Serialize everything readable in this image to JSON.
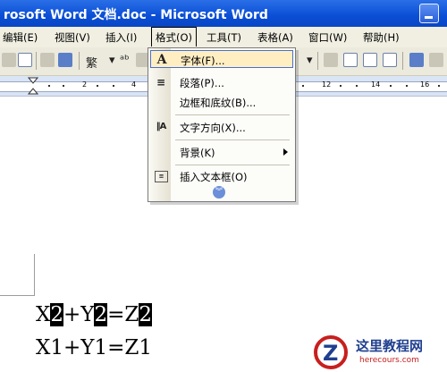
{
  "window": {
    "title": "rosoft Word 文档.doc - Microsoft Word"
  },
  "menubar": {
    "items": [
      {
        "label": "编辑(E)"
      },
      {
        "label": "视图(V)"
      },
      {
        "label": "插入(I)"
      },
      {
        "label": "格式(O)"
      },
      {
        "label": "工具(T)"
      },
      {
        "label": "表格(A)"
      },
      {
        "label": "窗口(W)"
      },
      {
        "label": "帮助(H)"
      }
    ]
  },
  "format_menu": {
    "items": [
      {
        "icon": "font-icon",
        "label": "字体(F)..."
      },
      {
        "icon": "paragraph-icon",
        "label": "段落(P)..."
      },
      {
        "icon": "",
        "label": "边框和底纹(B)..."
      },
      {
        "icon": "text-direction-icon",
        "label": "文字方向(X)..."
      },
      {
        "icon": "",
        "label": "背景(K)"
      },
      {
        "icon": "text-box-icon",
        "label": "插入文本框(O)"
      }
    ]
  },
  "ruler": {
    "labels": [
      "2",
      "4",
      "12",
      "14",
      "16"
    ]
  },
  "document": {
    "line1": {
      "a": "X",
      "b": "2",
      "c": "+Y",
      "d": "2",
      "e": "=Z",
      "f": "2"
    },
    "line2": "X1+Y1=Z1"
  },
  "watermark": {
    "brand": "这里教程网",
    "url": "herecours.com"
  }
}
